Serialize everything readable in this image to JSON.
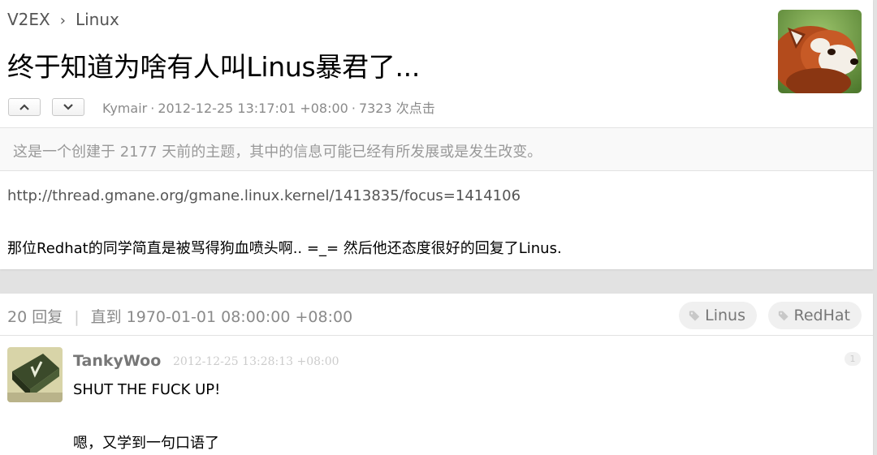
{
  "breadcrumb": {
    "site": "V2EX",
    "separator": "›",
    "node": "Linux"
  },
  "topic": {
    "title": "终于知道为啥有人叫Linus暴君了...",
    "author": "Kymair",
    "meta_dot": "·",
    "created": "2012-12-25 13:17:01 +08:00",
    "clicks": "7323 次点击",
    "notice": "这是一个创建于 2177 天前的主题，其中的信息可能已经有所发展或是发生改变。",
    "content_link": "http://thread.gmane.org/gmane.linux.kernel/1413835/focus=1414106",
    "content_body": "那位Redhat的同学简直是被骂得狗血喷头啊.. =_= 然后他还态度很好的回复了Linus."
  },
  "replies_header": {
    "count": "20 回复",
    "separator": "|",
    "until": "直到 1970-01-01 08:00:00 +08:00",
    "tags": [
      "Linus",
      "RedHat"
    ]
  },
  "reply": {
    "user": "TankyWoo",
    "time": "2012-12-25 13:28:13 +08:00",
    "floor": "1",
    "line1": "SHUT THE FUCK UP!",
    "line2": "嗯，又学到一句口语了"
  },
  "icons": {
    "vote_up": "chevron-up-icon",
    "vote_down": "chevron-down-icon",
    "tag": "tag-icon"
  },
  "colors": {
    "background": "#e2e2e2",
    "box": "#ffffff",
    "muted_text": "#8a8a8a",
    "tag_bg": "#f0f0f0"
  }
}
